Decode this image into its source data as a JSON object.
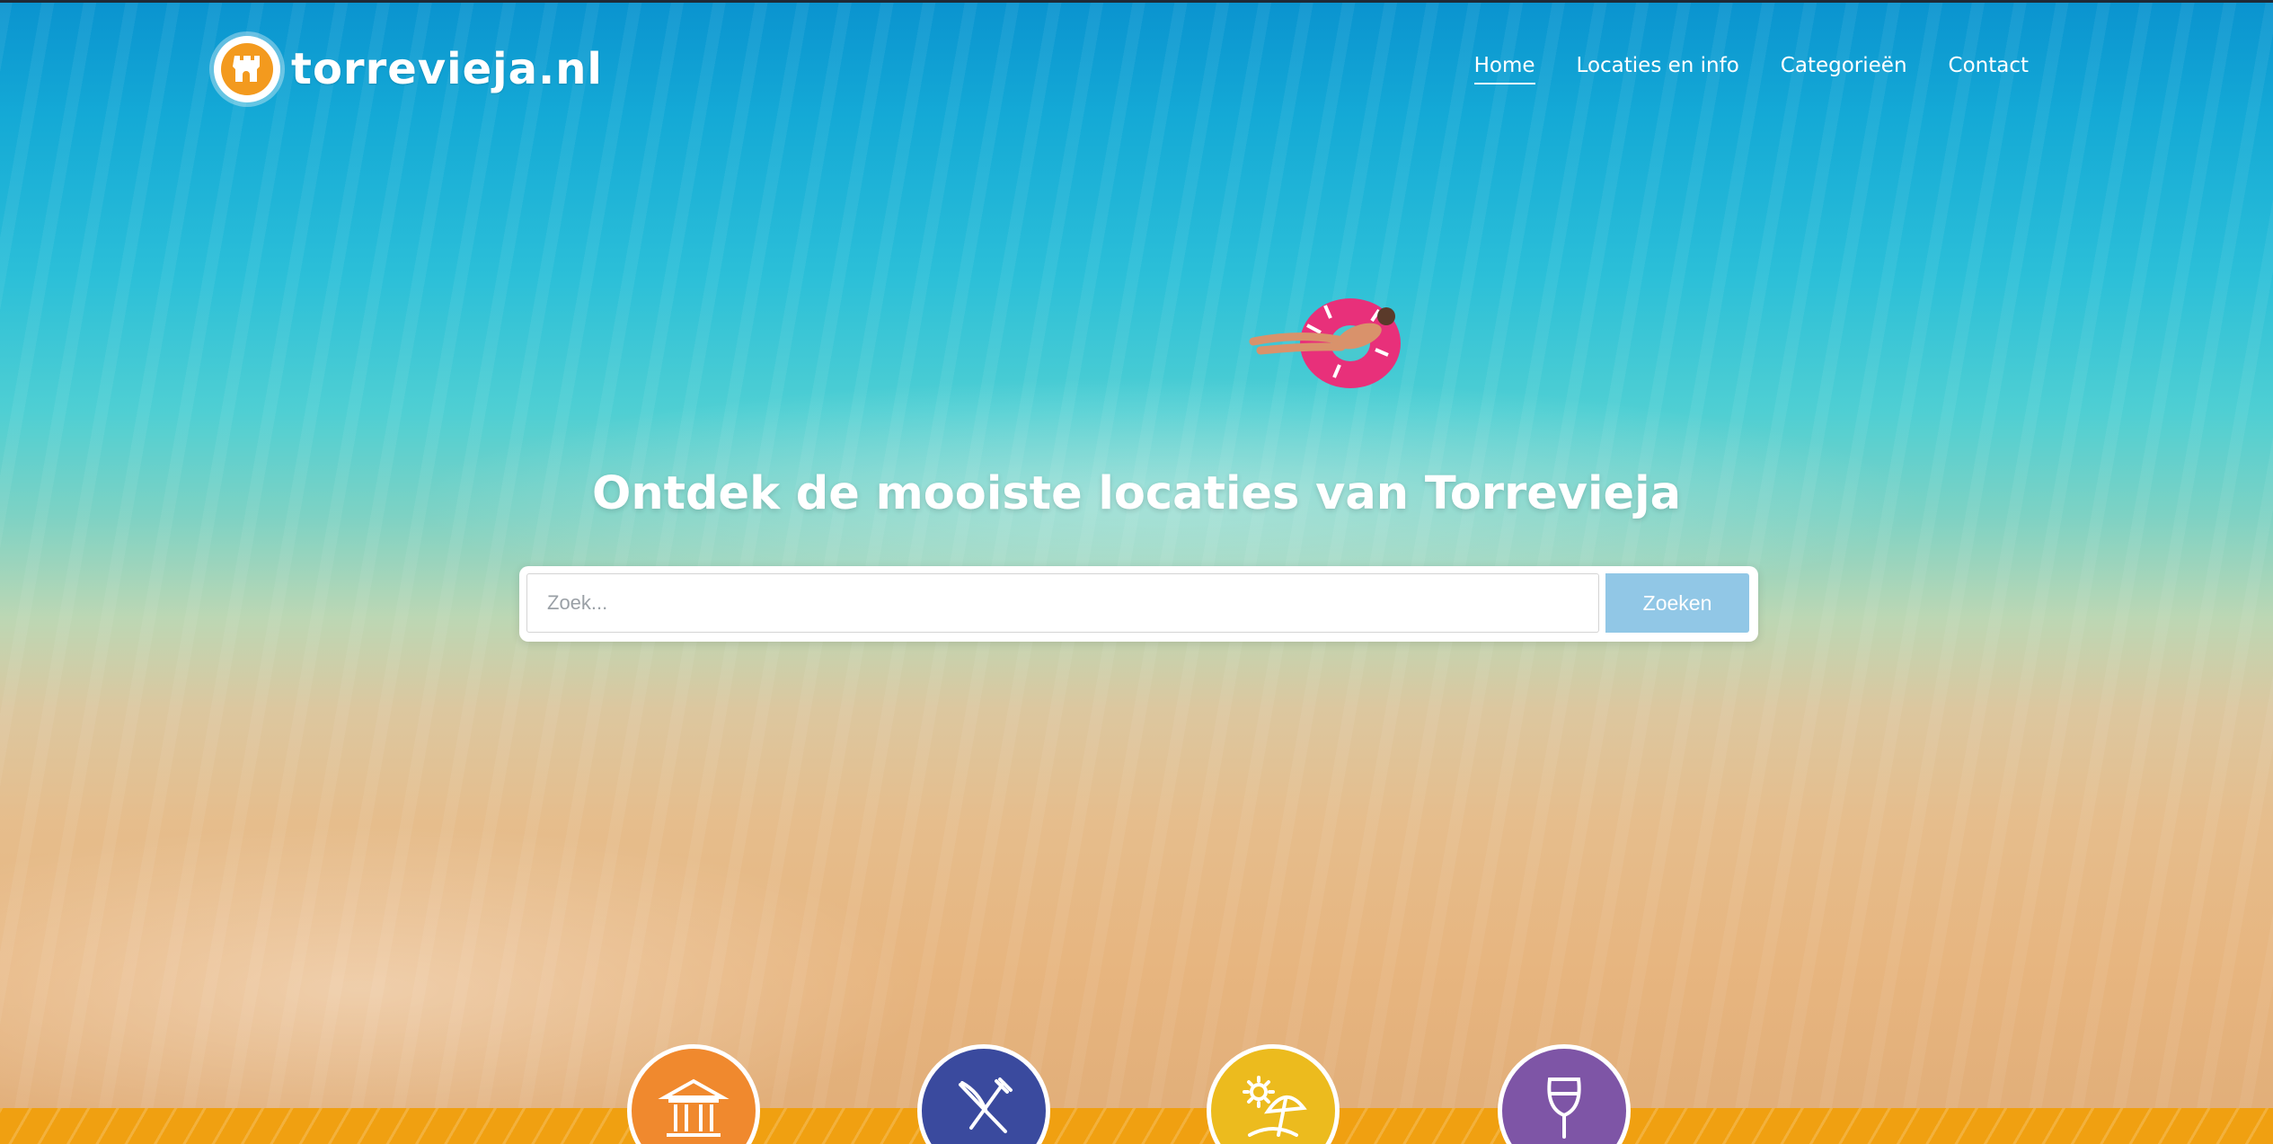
{
  "brand": {
    "name": "torrevieja.nl",
    "logo_icon": "castle-icon",
    "accent": "#f39a1e"
  },
  "nav": {
    "items": [
      {
        "label": "Home",
        "active": true
      },
      {
        "label": "Locaties en info",
        "active": false
      },
      {
        "label": "Categorieën",
        "active": false
      },
      {
        "label": "Contact",
        "active": false
      }
    ]
  },
  "hero": {
    "title": "Ontdek de mooiste locaties van Torrevieja",
    "search": {
      "placeholder": "Zoek...",
      "value": "",
      "button_label": "Zoeken"
    }
  },
  "categories": [
    {
      "icon": "museum-icon",
      "color": "#f0892e"
    },
    {
      "icon": "restaurant-icon",
      "color": "#3a4a9e"
    },
    {
      "icon": "beach-icon",
      "color": "#ecbb1e"
    },
    {
      "icon": "wine-glass-icon",
      "color": "#7e55a6"
    }
  ],
  "colors": {
    "band": "#f0a011",
    "search_button": "#91c7e6"
  }
}
